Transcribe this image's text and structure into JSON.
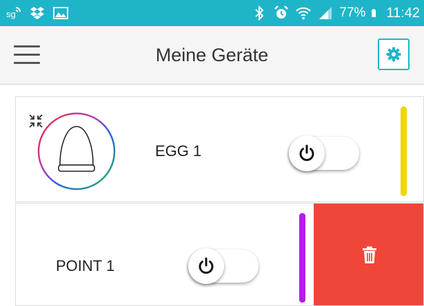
{
  "status_bar": {
    "battery": "77%",
    "time": "11:42",
    "icons_left": [
      "sync-icon",
      "dropbox-icon",
      "image-icon"
    ],
    "icons_right": [
      "bluetooth-icon",
      "alarm-icon",
      "wifi-icon",
      "signal-icon",
      "battery-icon"
    ]
  },
  "app_bar": {
    "title": "Meine Geräte",
    "menu_icon": "hamburger-menu-icon",
    "settings_icon": "gear-icon"
  },
  "devices": [
    {
      "name": "EGG 1",
      "power_on": false,
      "color": "#f2d602",
      "icon": "egg-lamp-icon"
    },
    {
      "name": "POINT 1",
      "power_on": false,
      "color": "#b21ee8",
      "delete_icon": "trash-icon"
    }
  ],
  "colors": {
    "accent": "#1fb5c8",
    "delete": "#f0463a"
  }
}
